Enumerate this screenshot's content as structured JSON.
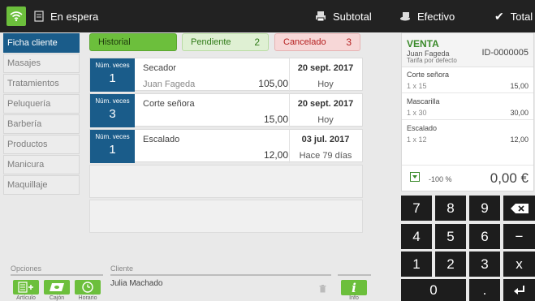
{
  "topbar": {
    "status": "En espera",
    "subtotal": "Subtotal",
    "payment": "Efectivo",
    "total": "Total"
  },
  "categories": [
    "Ficha cliente",
    "Masajes",
    "Tratamientos",
    "Peluquería",
    "Barbería",
    "Productos",
    "Manicura",
    "Maquillaje"
  ],
  "tabs": {
    "historial": "Historial",
    "pendiente": "Pendiente",
    "pendiente_count": "2",
    "cancelado": "Cancelado",
    "cancelado_count": "3"
  },
  "history": [
    {
      "times_label": "Núm. veces",
      "times": "1",
      "service": "Secador",
      "employee": "Juan Fageda",
      "amount": "105,00",
      "date": "20 sept. 2017",
      "relative": "Hoy"
    },
    {
      "times_label": "Núm. veces",
      "times": "3",
      "service": "Corte señora",
      "employee": "",
      "amount": "15,00",
      "date": "20 sept. 2017",
      "relative": "Hoy"
    },
    {
      "times_label": "Núm. veces",
      "times": "1",
      "service": "Escalado",
      "employee": "",
      "amount": "12,00",
      "date": "03 jul. 2017",
      "relative": "Hace 79 días"
    }
  ],
  "bottom": {
    "options_label": "Opciones",
    "client_label": "Cliente",
    "client_name": "Julia Machado",
    "buttons": [
      "Artículo",
      "Cajón",
      "Horario"
    ],
    "info": "Info"
  },
  "receipt": {
    "title": "VENTA",
    "customer": "Juan Fageda",
    "tariff": "Tarifa por defecto",
    "id": "ID-0000005",
    "items": [
      {
        "name": "Corte señora",
        "qty": "1 x 15",
        "price": "15,00"
      },
      {
        "name": "Mascarilla",
        "qty": "1 x 30",
        "price": "30,00"
      },
      {
        "name": "Escalado",
        "qty": "1 x 12",
        "price": "12,00"
      }
    ],
    "discount": "-100 %",
    "total": "0,00 €"
  },
  "keypad": [
    "7",
    "8",
    "9",
    "4",
    "5",
    "6",
    "−",
    "1",
    "2",
    "3",
    "x",
    "0",
    "."
  ],
  "colors": {
    "green": "#6cbf3c",
    "blue": "#1a5c8a",
    "dark": "#222222",
    "red": "#b52020"
  }
}
